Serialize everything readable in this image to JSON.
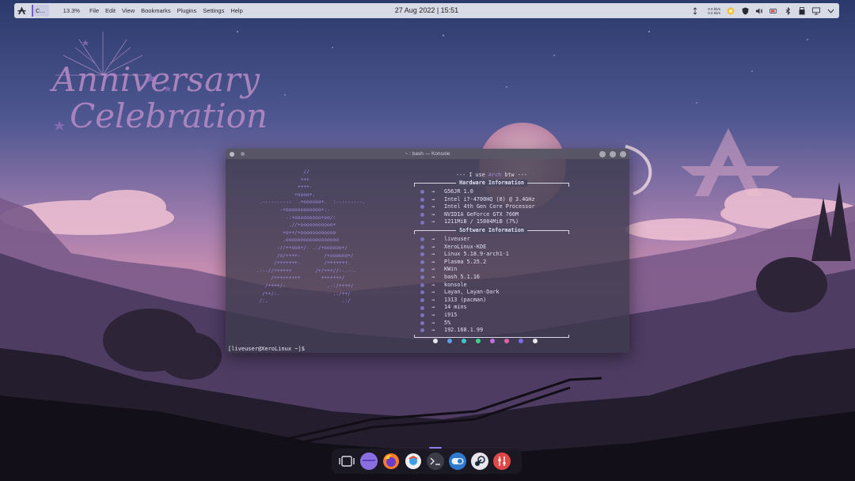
{
  "wallpaper": {
    "title_line1": "Anniversary",
    "title_line2": "Celebration"
  },
  "top_panel": {
    "launcher_icon": "xerolinux-logo-icon",
    "task_label": "C...",
    "cpu_usage": "13.3%",
    "menu": [
      "File",
      "Edit",
      "View",
      "Bookmarks",
      "Plugins",
      "Settings",
      "Help"
    ],
    "clock": "27 Aug 2022 | 15:51",
    "net_up": "0.0 kb/s",
    "net_down": "0.0 kb/s",
    "tray_icons": [
      "network-monitor-icon",
      "updates-icon",
      "shield-icon",
      "volume-icon",
      "battery-icon",
      "bluetooth-icon",
      "usb-icon",
      "display-icon",
      "chevron-down-icon"
    ]
  },
  "konsole": {
    "title": "~ : bash — Konsole",
    "ascii_art": [
      "                     //",
      "                    +++",
      "                   ++++-",
      "                  +oooo+.",
      "      .---------:  .+oooooo+.  :---------.",
      "             -+oooooooooooo+:-",
      "               -:+ooooooooo+oo/:",
      "                .//+ooooooooooo+",
      "              +o++/+oooooooooooo",
      "              .oooooooooooooooooo",
      "            -//++ooo+/- .:/+oooooo+/",
      "            /o/++++-        /+oooooo+/",
      "           /+++++++.        /+++++++.",
      "     .---//++++++        /+/+++//:-.--.",
      "          /+++++++++       +++++++/",
      "        /++++/-              .-:/++++/",
      "       /++/:.                  .:/++/",
      "      /:.                         .:/"
    ],
    "banner_prefix": "--- I use ",
    "banner_arch": "Arch",
    "banner_suffix": " btw ---",
    "hardware_label": "Hardware Information",
    "software_label": "Software Information",
    "arrow": "→",
    "hardware": [
      "G56JR 1.0",
      "Intel i7-4700HQ (8) @ 3.4GHz",
      "Intel 4th Gen Core Processor",
      "NVIDIA GeForce GTX 760M",
      "1211MiB / 15884MiB (7%)"
    ],
    "software": [
      "liveuser",
      "XeroLinux-KDE",
      "Linux 5.18.9-arch1-1",
      "Plasma 5.25.2",
      "KWin",
      "bash 5.1.16",
      "konsole",
      "Layan, Layan-Dark",
      "1313 (pacman)",
      "14 mins",
      "i915",
      "5%",
      "192.168.1.99"
    ],
    "color_dots": [
      "#e6e6ea",
      "#5aa0e8",
      "#3fc6c6",
      "#3fd08a",
      "#c06ee0",
      "#e060a6",
      "#7f6be6",
      "#e8e8ee"
    ],
    "prompt": "[liveuser@XeroLinux ~]$"
  },
  "dock": {
    "items": [
      "overview-icon",
      "launcher-icon",
      "firefox-icon",
      "browser-icon",
      "konsole-icon",
      "toggle-icon",
      "steam-icon",
      "settings-icon"
    ]
  }
}
